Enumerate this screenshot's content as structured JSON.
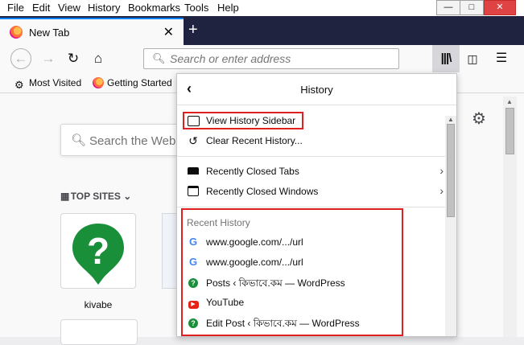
{
  "menubar": {
    "items": [
      "File",
      "Edit",
      "View",
      "History",
      "Bookmarks",
      "Tools",
      "Help"
    ]
  },
  "window_controls": {
    "minimize": "—",
    "maximize": "□",
    "close": "✕"
  },
  "tab": {
    "title": "New Tab",
    "close": "✕"
  },
  "new_tab_button": "+",
  "navbar": {
    "back": "←",
    "forward": "→",
    "reload": "↻",
    "home": "⌂",
    "search_placeholder": "Search or enter address",
    "library": "|||\\",
    "sidebar": "◫",
    "menu": "☰"
  },
  "bookmarks": [
    {
      "label": "Most Visited",
      "icon": "gear-icon"
    },
    {
      "label": "Getting Started",
      "icon": "firefox-icon"
    }
  ],
  "newtab_page": {
    "search_placeholder": "Search the Web",
    "top_sites_heading": "TOP SITES",
    "tile_label": "kivabe"
  },
  "history_panel": {
    "title": "History",
    "view_sidebar": "View History Sidebar",
    "clear_recent": "Clear Recent History...",
    "recently_closed_tabs": "Recently Closed Tabs",
    "recently_closed_windows": "Recently Closed Windows",
    "recent_history_heading": "Recent History",
    "recent_items": [
      {
        "label": "www.google.com/.../url",
        "icon": "google-icon"
      },
      {
        "label": "www.google.com/.../url",
        "icon": "google-icon"
      },
      {
        "label": "Posts ‹ কিভাবে.কম — WordPress",
        "icon": "kivabe-icon"
      },
      {
        "label": "YouTube",
        "icon": "youtube-icon"
      },
      {
        "label": "Edit Post ‹ কিভাবে.কম — WordPress",
        "icon": "kivabe-icon"
      }
    ]
  },
  "colors": {
    "highlight": "#e02020",
    "accent": "#0a84ff"
  }
}
